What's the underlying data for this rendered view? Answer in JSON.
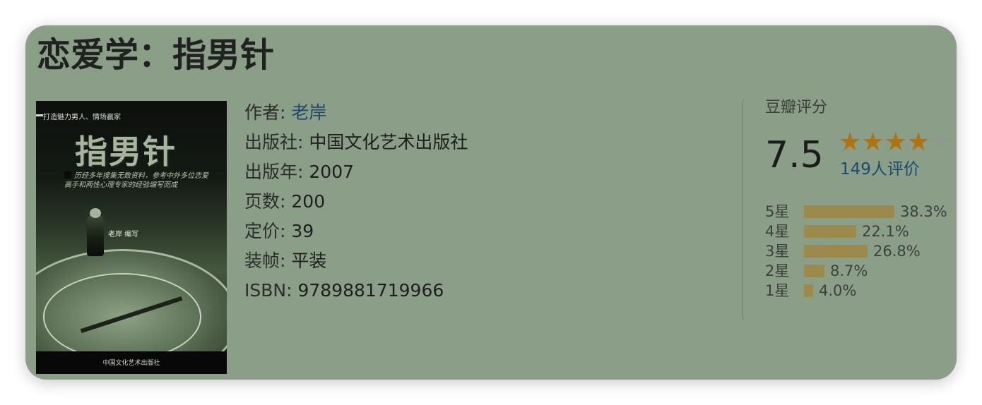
{
  "book": {
    "title": "恋爱学：指男针",
    "cover": {
      "tagline": "打造魅力男人、情场赢家",
      "cover_title": "指男针",
      "blurb": "历经多年搜集无数资料，参考中外多位恋爱高手和两性心理专家的经验编写而成",
      "cover_author": "老岸 编写",
      "cover_publisher": "中国文化艺术出版社"
    },
    "info": {
      "author_label": "作者:",
      "author": "老岸",
      "publisher_label": "出版社:",
      "publisher": "中国文化艺术出版社",
      "year_label": "出版年:",
      "year": "2007",
      "pages_label": "页数:",
      "pages": "200",
      "price_label": "定价:",
      "price": "39",
      "binding_label": "装帧:",
      "binding": "平装",
      "isbn_label": "ISBN:",
      "isbn": "9789881719966"
    }
  },
  "rating": {
    "heading": "豆瓣评分",
    "score": "7.5",
    "stars_filled": 4,
    "stars_total": 5,
    "count": "149人评价",
    "star_color": "#b07310",
    "bar_color": "#9c8a4c",
    "distribution": [
      {
        "label": "5星",
        "percent": 38.3,
        "text": "38.3%"
      },
      {
        "label": "4星",
        "percent": 22.1,
        "text": "22.1%"
      },
      {
        "label": "3星",
        "percent": 26.8,
        "text": "26.8%"
      },
      {
        "label": "2星",
        "percent": 8.7,
        "text": "8.7%"
      },
      {
        "label": "1星",
        "percent": 4.0,
        "text": "4.0%"
      }
    ]
  }
}
